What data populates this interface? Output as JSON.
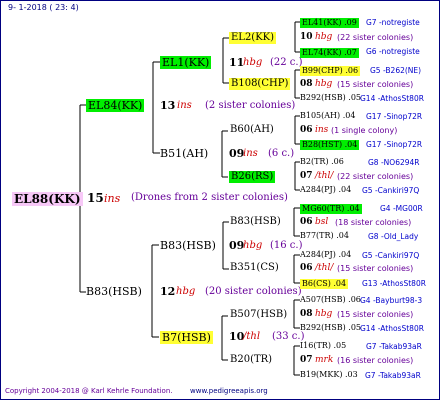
{
  "header": {
    "date": "9-  1-2018 ( 23: 4)"
  },
  "footer": {
    "copyright": "Copyright 2004-2018 @ Karl Kehrle Foundation.",
    "url": "www.pedigreeapis.org"
  },
  "root": {
    "name": "EL88(KK)",
    "number": "15",
    "breeder": "ins",
    "note": "(Drones from 2 sister colonies)"
  },
  "gen1": [
    {
      "name": "EL84(KK)",
      "number": "13",
      "breeder": "ins",
      "note": "(2 sister colonies)"
    },
    {
      "name": "B83(HSB)",
      "number": "12",
      "breeder": "hbg",
      "note": "(20 sister colonies)"
    }
  ],
  "gen2": [
    {
      "name": "EL1(KK)",
      "number": "11",
      "breeder": "hbg",
      "note": "(22 c.)"
    },
    {
      "name": "B51(AH)",
      "number": "09",
      "breeder": "ins",
      "note": "(6 c.)"
    },
    {
      "name": "B83(HSB)",
      "number": "09",
      "breeder": "hbg",
      "note": "(16 c.)"
    },
    {
      "name": "B7(HSB)",
      "number": "10",
      "breeder": "/thl",
      "note": "(33 c.)"
    }
  ],
  "gen3": [
    {
      "name": "EL2(KK)",
      "number": "10",
      "breeder": "hbg",
      "note": "(22 sister colonies)"
    },
    {
      "name": "B108(CHP)",
      "number": "08",
      "breeder": "hbg",
      "note": "(15 sister colonies)"
    },
    {
      "name": "B60(AH)",
      "number": "06",
      "breeder": "ins",
      "note": "(1 single colony)"
    },
    {
      "name": "B26(RS)",
      "number": "07",
      "breeder": "/thl/",
      "note": "(22 sister colonies)"
    },
    {
      "name": "B83(HSB)",
      "number": "06",
      "breeder": "bsl",
      "note": "(18 sister colonies)"
    },
    {
      "name": "B351(CS)",
      "number": "06",
      "breeder": "/thl/",
      "note": "(15 sister colonies)"
    },
    {
      "name": "B507(HSB)",
      "number": "08",
      "breeder": "hbg",
      "note": "(15 sister colonies)"
    },
    {
      "name": "B20(TR)",
      "number": "07",
      "breeder": "mrk",
      "note": "(16 sister colonies)"
    }
  ],
  "gen4": [
    {
      "name": "EL41(KK)",
      "num": ".09",
      "ref": "G7 -notregiste"
    },
    {
      "name": "EL74(KK)",
      "num": ".07",
      "ref": "G6 -notregiste"
    },
    {
      "name": "B99(CHP)",
      "num": ".06",
      "ref": "G5 -B262(NE)"
    },
    {
      "name": "B292(HSB)",
      "num": ".05",
      "ref": "G14 -AthosSt80R"
    },
    {
      "name": "B105(AH)",
      "num": ".04",
      "ref": "G17 -Sinop72R"
    },
    {
      "name": "B28(HST)",
      "num": ".04",
      "ref": "G17 -Sinop72R"
    },
    {
      "name": "B2(TR)",
      "num": ".06",
      "ref": "G8 -NO6294R"
    },
    {
      "name": "A284(PJ)",
      "num": ".04",
      "ref": "G5 -Cankiri97Q"
    },
    {
      "name": "MG60(TR)",
      "num": ".04",
      "ref": "G4 -MG00R"
    },
    {
      "name": "B77(TR)",
      "num": ".04",
      "ref": "G8 -Old_Lady"
    },
    {
      "name": "A284(PJ)",
      "num": ".04",
      "ref": "G5 -Cankiri97Q"
    },
    {
      "name": "B6(CS)",
      "num": ".04",
      "ref": "G13 -AthosSt80R"
    },
    {
      "name": "A507(HSB)",
      "num": ".06",
      "ref": "G4 -Bayburt98-3"
    },
    {
      "name": "B292(HSB)",
      "num": ".05",
      "ref": "G14 -AthosSt80R"
    },
    {
      "name": "I16(TR)",
      "num": ".05",
      "ref": "G7 -Takab93aR"
    },
    {
      "name": "B19(MKK)",
      "num": ".03",
      "ref": "G7 -Takab93aR"
    }
  ],
  "colors": {
    "green_box": "#00ee00",
    "yellow_box": "#ffff33",
    "pink_box": "#f7c8f7",
    "lines": "#000000",
    "frame": "#000080"
  }
}
